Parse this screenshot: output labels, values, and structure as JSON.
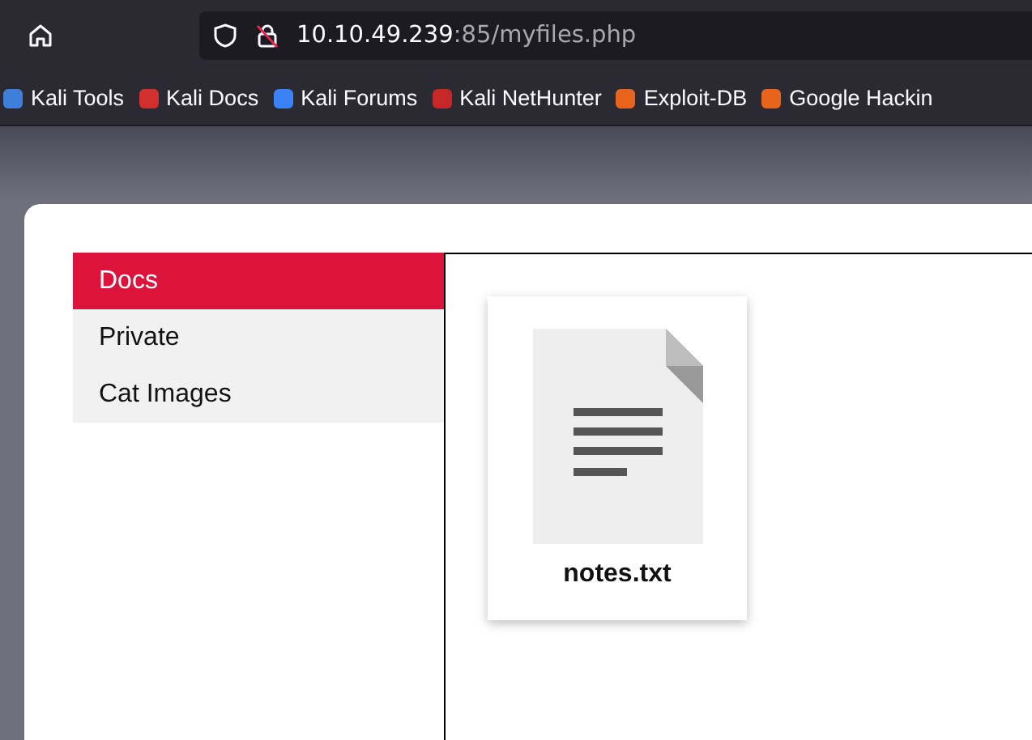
{
  "address_bar": {
    "host": "10.10.49.239",
    "path": ":85/myfiles.php"
  },
  "bookmarks": [
    {
      "label": "Kali Tools",
      "color": "#3d7fd9"
    },
    {
      "label": "Kali Docs",
      "color": "#d32f2f"
    },
    {
      "label": "Kali Forums",
      "color": "#3b82f6"
    },
    {
      "label": "Kali NetHunter",
      "color": "#c62828"
    },
    {
      "label": "Exploit-DB",
      "color": "#e8641c"
    },
    {
      "label": "Google Hackin",
      "color": "#e8641c"
    }
  ],
  "sidebar": {
    "items": [
      {
        "label": "Docs",
        "selected": true
      },
      {
        "label": "Private",
        "selected": false
      },
      {
        "label": "Cat Images",
        "selected": false
      }
    ]
  },
  "files": [
    {
      "name": "notes.txt"
    }
  ]
}
